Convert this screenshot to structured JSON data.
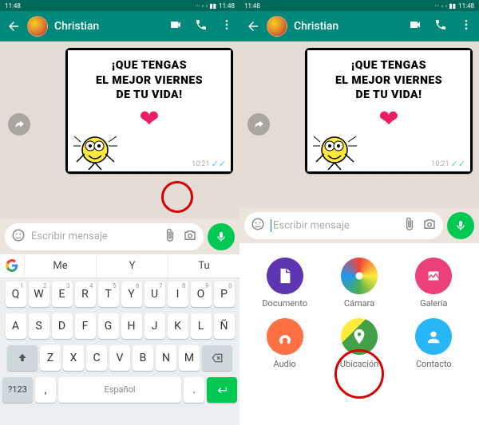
{
  "status": {
    "time_left": "11:48",
    "time_right": "11:48"
  },
  "header": {
    "contact": "Christian"
  },
  "message": {
    "line1": "¡QUE TENGAS",
    "line2": "EL MEJOR VIERNES",
    "line3": "DE TU VIDA!",
    "time": "10:21"
  },
  "input": {
    "placeholder": "Escribir mensaje"
  },
  "suggestions": {
    "a": "Me",
    "b": "Y",
    "c": "Tu"
  },
  "kb": {
    "row1": [
      "Q",
      "W",
      "E",
      "R",
      "T",
      "Y",
      "U",
      "I",
      "O",
      "P"
    ],
    "row1sup": [
      "1",
      "2",
      "3",
      "4",
      "5",
      "6",
      "7",
      "8",
      "9",
      "0"
    ],
    "row2": [
      "A",
      "S",
      "D",
      "F",
      "G",
      "H",
      "J",
      "K",
      "L",
      "Ñ"
    ],
    "row3": [
      "Z",
      "X",
      "C",
      "V",
      "B",
      "N",
      "M"
    ],
    "mode": "?123",
    "lang": "Español"
  },
  "attach": {
    "doc": "Documento",
    "cam": "Cámara",
    "gal": "Galería",
    "aud": "Audio",
    "loc": "Ubicación",
    "con": "Contacto"
  }
}
